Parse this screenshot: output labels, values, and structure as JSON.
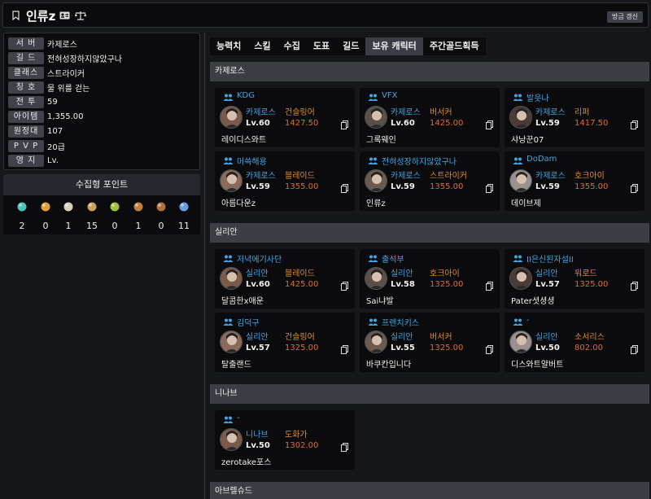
{
  "header": {
    "name": "인류z",
    "refresh_label": "방금 갱신"
  },
  "info": {
    "rows": [
      {
        "label": "서 버",
        "value": "카제로스"
      },
      {
        "label": "길 드",
        "value": "전혀성장하지않았구나"
      },
      {
        "label": "클래스",
        "value": "스트라이커"
      },
      {
        "label": "칭 호",
        "value": "물 위를 걷는"
      },
      {
        "label": "전 투",
        "value": "59"
      },
      {
        "label": "아이템",
        "value": "1,355.00"
      },
      {
        "label": "원정대",
        "value": "107"
      },
      {
        "label": "P V P",
        "value": "20급"
      },
      {
        "label": "영 지",
        "value": "Lv."
      }
    ]
  },
  "points": {
    "title": "수집형 포인트",
    "items": [
      {
        "icon": "island-heart-icon",
        "color": "#4fc3b5",
        "count": "2"
      },
      {
        "icon": "orpheus-star-icon",
        "color": "#e0a040",
        "count": "0"
      },
      {
        "icon": "giant-heart-icon",
        "color": "#d8d0c0",
        "count": "1"
      },
      {
        "icon": "artwork-icon",
        "color": "#c8a060",
        "count": "15"
      },
      {
        "icon": "mokoko-seed-icon",
        "color": "#a0c040",
        "count": "0"
      },
      {
        "icon": "sea-bounty-icon",
        "color": "#c08040",
        "count": "1"
      },
      {
        "icon": "world-tree-leaf-icon",
        "color": "#b07040",
        "count": "0"
      },
      {
        "icon": "ignea-token-icon",
        "color": "#6aa0e0",
        "count": "11"
      }
    ]
  },
  "tabs": [
    "능력치",
    "스킬",
    "수집",
    "도표",
    "길드",
    "보유 캐릭터",
    "주간골드획득"
  ],
  "active_tab": "보유 캐릭터",
  "servers": [
    {
      "name": "카제로스",
      "characters": [
        {
          "guild": "KDG",
          "server": "카제로스",
          "class": "건슬링어",
          "level": "Lv.60",
          "item_level": "1427.50",
          "name": "레이디스와트"
        },
        {
          "guild": "VFX",
          "server": "카제로스",
          "class": "버서커",
          "level": "Lv.60",
          "item_level": "1425.00",
          "name": "그록웨인"
        },
        {
          "guild": "발읏나",
          "server": "카제로스",
          "class": "리퍼",
          "level": "Lv.59",
          "item_level": "1417.50",
          "name": "샤낭꾼07"
        },
        {
          "guild": "머쓱해용",
          "server": "카제로스",
          "class": "블레이드",
          "level": "Lv.59",
          "item_level": "1355.00",
          "name": "아름다운z"
        },
        {
          "guild": "전혀성장하지않았구나",
          "server": "카제로스",
          "class": "스트라이커",
          "level": "Lv.59",
          "item_level": "1355.00",
          "name": "인류z"
        },
        {
          "guild": "DoDam",
          "server": "카제로스",
          "class": "호크아이",
          "level": "Lv.59",
          "item_level": "1355.00",
          "name": "데이브제"
        }
      ]
    },
    {
      "name": "실리안",
      "characters": [
        {
          "guild": "저녁에기사단",
          "server": "실리안",
          "class": "블레이드",
          "level": "Lv.60",
          "item_level": "1425.00",
          "name": "달콤한x애운"
        },
        {
          "guild": "출석부",
          "server": "실리안",
          "class": "호크아이",
          "level": "Lv.58",
          "item_level": "1325.00",
          "name": "Sai냐발"
        },
        {
          "guild": "II은신된자설II",
          "server": "실리안",
          "class": "워로드",
          "level": "Lv.57",
          "item_level": "1325.00",
          "name": "Pater셧셩셩"
        },
        {
          "guild": "김덕구",
          "server": "실리안",
          "class": "건슬링어",
          "level": "Lv.57",
          "item_level": "1325.00",
          "name": "탈출랜드"
        },
        {
          "guild": "프렌치키스",
          "server": "실리안",
          "class": "버서커",
          "level": "Lv.55",
          "item_level": "1325.00",
          "name": "바쿠칸입니다"
        },
        {
          "guild": "-",
          "server": "실리안",
          "class": "소서리스",
          "level": "Lv.50",
          "item_level": "802.00",
          "name": "디스와트얄버트"
        }
      ]
    },
    {
      "name": "니나브",
      "characters": [
        {
          "guild": "-",
          "server": "니나브",
          "class": "도화가",
          "level": "Lv.50",
          "item_level": "1302.00",
          "name": "zerotake포스"
        }
      ]
    },
    {
      "name": "아브렐슈드",
      "characters": []
    }
  ]
}
